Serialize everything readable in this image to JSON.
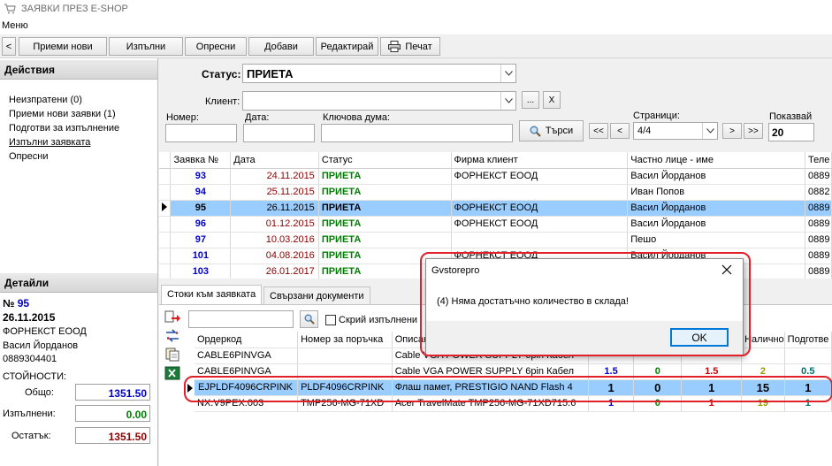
{
  "window": {
    "title": "ЗАЯВКИ ПРЕЗ E-SHOP"
  },
  "menu": {
    "label": "Меню"
  },
  "toolbar": {
    "back": "<",
    "buttons": [
      "Приеми нови",
      "Изпълни",
      "Опресни",
      "Добави",
      "Редактирай",
      "Печат"
    ]
  },
  "actions": {
    "header": "Действия",
    "items": [
      "Неизпратени (0)",
      "Приеми нови заявки (1)",
      "Подготви за изпълнение",
      "Изпълни заявката",
      "Опресни"
    ]
  },
  "details": {
    "header": "Детайли",
    "number_prefix": "№",
    "number": "95",
    "date": "26.11.2015",
    "company": "ФОРНЕКСТ ЕООД",
    "person": "Васил Йорданов",
    "phone": "0889304401",
    "values_label": "СТОЙНОСТИ:",
    "total_label": "Общо:",
    "total": "1351.50",
    "done_label": "Изпълнени:",
    "done": "0.00",
    "rest_label": "Остатък:",
    "rest": "1351.50"
  },
  "filters": {
    "status_label": "Статус:",
    "status_value": "ПРИЕТА",
    "client_label": "Клиент:",
    "client_browse": "...",
    "client_clear": "X",
    "number_label": "Номер:",
    "date_label": "Дата:",
    "keyword_label": "Ключова дума:",
    "search_button": "Търси",
    "pages_label": "Страници:",
    "page_first": "<<",
    "page_prev": "<",
    "page_value": "4/4",
    "page_next": ">",
    "page_last": ">>",
    "show_label": "Показвай",
    "show_value": "20"
  },
  "orders": {
    "columns": [
      "Заявка №",
      "Дата",
      "Статус",
      "Фирма клиент",
      "Частно лице - име",
      "Теле"
    ],
    "rows": [
      {
        "no": "93",
        "date": "24.11.2015",
        "status": "ПРИЕТА",
        "company": "ФОРНЕКСТ ЕООД",
        "person": "Васил Йорданов",
        "phone": "0889"
      },
      {
        "no": "94",
        "date": "25.11.2015",
        "status": "ПРИЕТА",
        "company": "",
        "person": "Иван Попов",
        "phone": "0882"
      },
      {
        "no": "95",
        "date": "26.11.2015",
        "status": "ПРИЕТА",
        "company": "ФОРНЕКСТ ЕООД",
        "person": "Васил Йорданов",
        "phone": "0889"
      },
      {
        "no": "96",
        "date": "01.12.2015",
        "status": "ПРИЕТА",
        "company": "ФОРНЕКСТ ЕООД",
        "person": "Васил Йорданов",
        "phone": "0889"
      },
      {
        "no": "97",
        "date": "10.03.2016",
        "status": "ПРИЕТА",
        "company": "",
        "person": "Пешо",
        "phone": "0889"
      },
      {
        "no": "101",
        "date": "04.08.2016",
        "status": "ПРИЕТА",
        "company": "ФОРНЕКСТ ЕООД",
        "person": "Васил Йорданов",
        "phone": "0889"
      },
      {
        "no": "103",
        "date": "26.01.2017",
        "status": "ПРИЕТА",
        "company": "ФОРНЕКСТ ЕООД",
        "person": "Васил Йорданов",
        "phone": "0889"
      }
    ],
    "selected_index": 2
  },
  "tabs": [
    "Стоки към заявката",
    "Свързани документи"
  ],
  "items_filter": {
    "hide_done_label": "Скрий изпълнени"
  },
  "items": {
    "columns": [
      "Ордеркод",
      "Номер за поръчка",
      "Описание",
      "",
      "",
      "",
      "Налично",
      "Подготве"
    ],
    "rows": [
      {
        "code": "CABLE6PINVGA",
        "order": "",
        "desc": "Cable VGA POWER SUPPLY 6pin Кабел",
        "q1": "",
        "q2": "",
        "q3": "",
        "avail": "",
        "prep": ""
      },
      {
        "code": "CABLE6PINVGA",
        "order": "",
        "desc": "Cable VGA POWER SUPPLY 6pin Кабел",
        "q1": "1.5",
        "q2": "0",
        "q3": "1.5",
        "avail": "2",
        "prep": "0.5"
      },
      {
        "code": "EJPLDF4096CRPINK",
        "order": "PLDF4096CRPINK",
        "desc": "Флаш памет, PRESTIGIO NAND Flash 4",
        "q1": "1",
        "q2": "0",
        "q3": "1",
        "avail": "15",
        "prep": "1"
      },
      {
        "code": "NX.V9PEX.003",
        "order": "TMP256-MG-71XD",
        "desc": "Acer TravelMate TMP256-MG-71XD715.6",
        "q1": "1",
        "q2": "0",
        "q3": "1",
        "avail": "19",
        "prep": "1"
      }
    ],
    "selected_index": 2
  },
  "dialog": {
    "title": "Gvstorepro",
    "message": "(4) Няма достатъчно количество в склада!",
    "ok": "OK"
  },
  "colors": {
    "selection": "#99ccff",
    "status_green": "#008000",
    "order_blue": "#0000cc",
    "date_red": "#8b0000",
    "highlight_ring": "#e0202a"
  }
}
